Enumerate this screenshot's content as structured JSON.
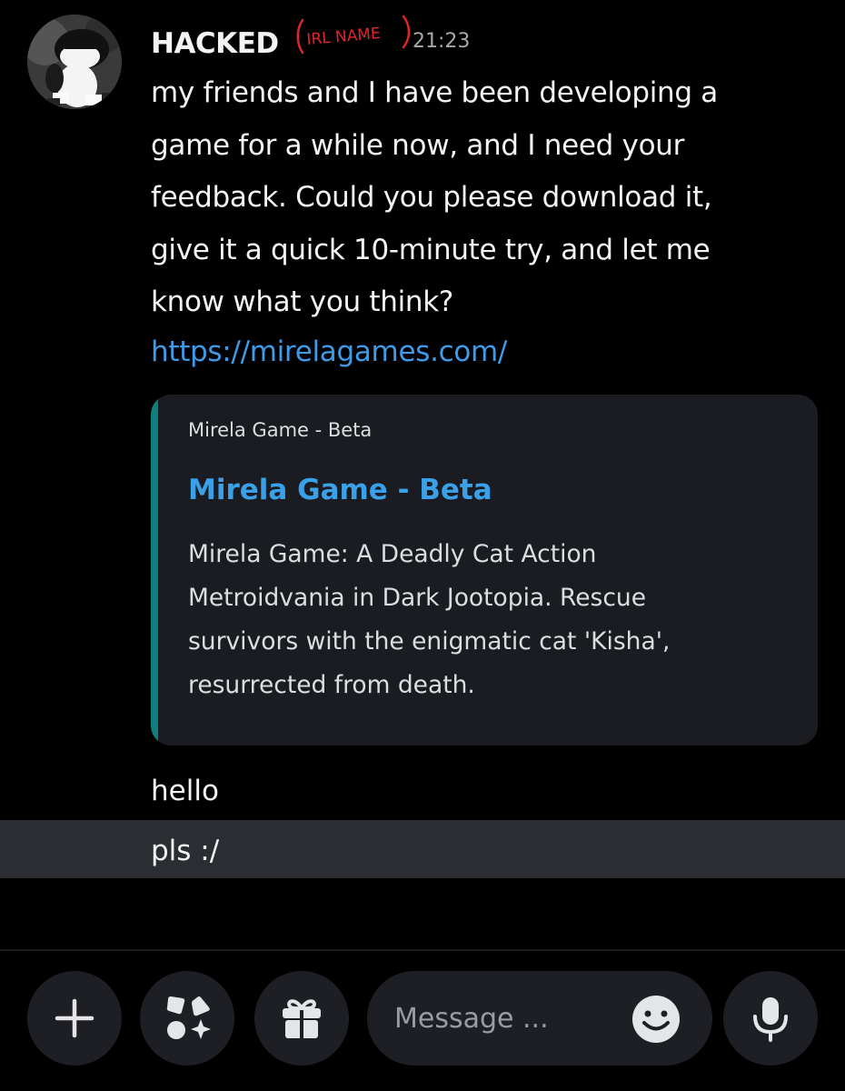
{
  "message": {
    "username": "HACKED",
    "annotation": "IRL NAME",
    "timestamp": "21:23",
    "body_lines": [
      "my friends and I have been developing a",
      "game for a while now, and I need your",
      "feedback. Could you please download it,",
      "give it a quick 10-minute try, and let me",
      "know what you think?"
    ],
    "link": "https://mirelagames.com/"
  },
  "embed": {
    "provider": "Mirela Game - Beta",
    "title": "Mirela Game - Beta",
    "description_lines": [
      "Mirela Game: A Deadly Cat Action",
      "Metroidvania in Dark Jootopia. Rescue",
      "survivors with the enigmatic cat 'Kisha',",
      "resurrected from death."
    ],
    "accent_color": "#0e7f7b"
  },
  "followups": [
    {
      "text": "hello"
    },
    {
      "text": "pls :/"
    }
  ],
  "composer": {
    "placeholder": "Message ...",
    "buttons": [
      {
        "icon": "plus-icon"
      },
      {
        "icon": "apps-icon"
      },
      {
        "icon": "gift-icon"
      },
      {
        "icon": "emoji-icon"
      },
      {
        "icon": "microphone-icon"
      }
    ]
  },
  "colors": {
    "background": "#000000",
    "text": "#f2f3f5",
    "link": "#3d9be9",
    "embed_background": "#1b1c21",
    "highlight_row": "#2b2d33",
    "annotation_red": "#e0242a"
  }
}
